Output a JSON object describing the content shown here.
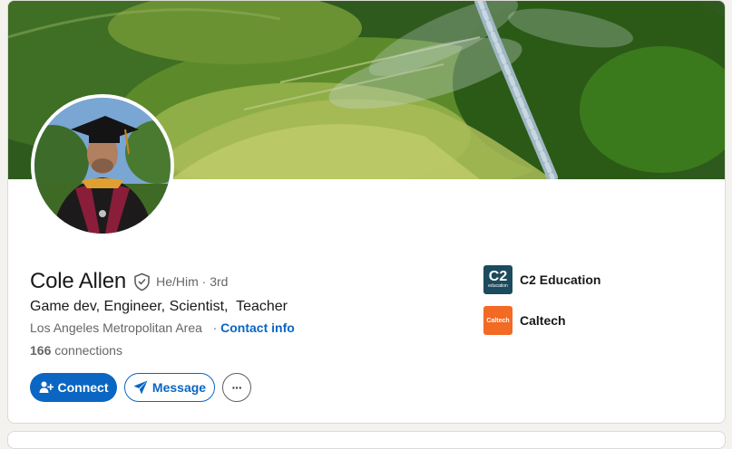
{
  "profile": {
    "name": "Cole Allen",
    "pronouns": "He/Him",
    "degree": "· 3rd",
    "headline": "Game dev, Engineer, Scientist,  Teacher",
    "location": "Los Angeles Metropolitan Area",
    "separator": "·",
    "contact_info": "Contact info",
    "connections_count": "166",
    "connections_label": "connections"
  },
  "actions": {
    "connect": "Connect",
    "message": "Message",
    "more": "···"
  },
  "organizations": [
    {
      "name": "C2 Education",
      "logo_text": "C2",
      "logo_subtext": "education",
      "color": "#1c4a5e"
    },
    {
      "name": "Caltech",
      "logo_text": "Caltech",
      "color": "#f26a24"
    }
  ],
  "colors": {
    "accent": "#0a66c2",
    "text": "#191919",
    "muted": "#666666"
  },
  "icons": {
    "verify": "shield-check-icon",
    "connect": "add-person-icon",
    "message": "paper-plane-icon",
    "more": "ellipsis-icon"
  }
}
